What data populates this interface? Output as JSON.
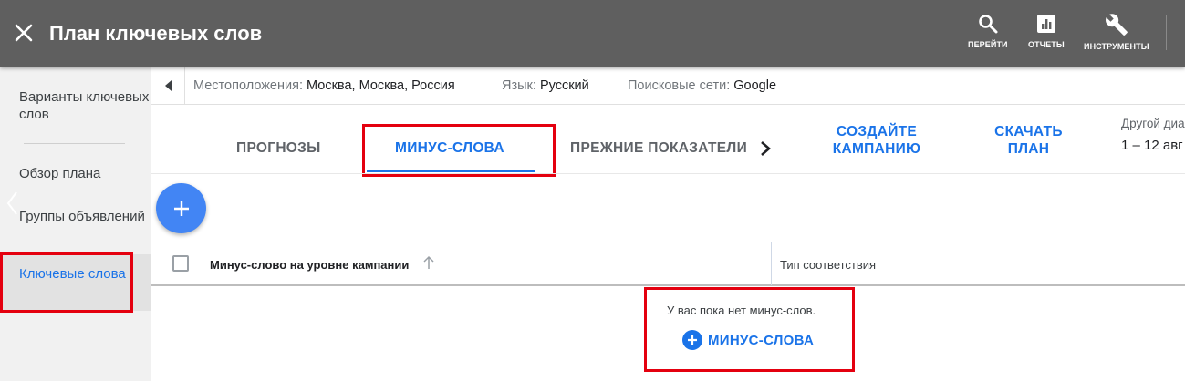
{
  "topbar": {
    "title": "План ключевых слов",
    "tools": [
      {
        "label": "ПЕРЕЙТИ",
        "icon": "search-icon"
      },
      {
        "label": "ОТЧЕТЫ",
        "icon": "reports-icon"
      },
      {
        "label": "ИНСТРУМЕНТЫ",
        "icon": "wrench-icon"
      }
    ]
  },
  "sidebar": {
    "items": [
      {
        "label": "Варианты ключевых слов"
      },
      {
        "label": "Обзор плана"
      },
      {
        "label": "Группы объявлений"
      },
      {
        "label": "Ключевые слова",
        "active": true
      }
    ]
  },
  "filters": [
    {
      "key": "Местоположения:",
      "value": "Москва, Москва, Россия"
    },
    {
      "key": "Язык:",
      "value": "Русский"
    },
    {
      "key": "Поисковые сети:",
      "value": "Google"
    }
  ],
  "tabs": [
    {
      "label": "ПРОГНОЗЫ"
    },
    {
      "label": "МИНУС-СЛОВА",
      "active": true
    },
    {
      "label": "ПРЕЖНИЕ ПОКАЗАТЕЛИ"
    }
  ],
  "actions": {
    "create_campaign": "СОЗДАЙТЕ КАМПАНИЮ",
    "download_plan": "СКАЧАТЬ ПЛАН"
  },
  "date_range": {
    "label": "Другой диа",
    "value": "1 – 12 авг"
  },
  "table": {
    "columns": [
      "Минус-слово на уровне кампании",
      "Тип соответствия"
    ],
    "empty_message": "У вас пока нет минус-слов.",
    "add_label": "МИНУС-СЛОВА"
  },
  "colors": {
    "topbar": "#5f5f5f",
    "accent": "#1a73e8",
    "fab": "#4285f4",
    "highlight": "#e4000f"
  }
}
